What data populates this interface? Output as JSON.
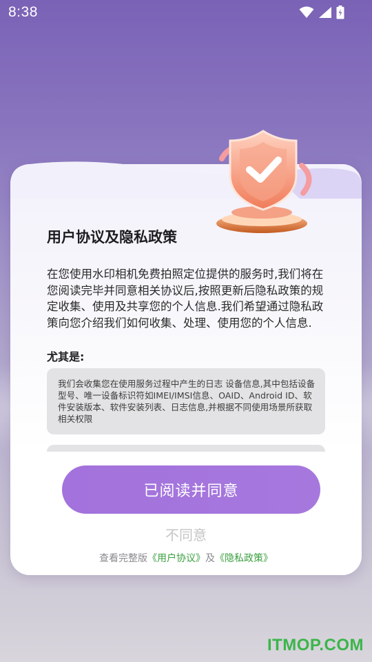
{
  "status_bar": {
    "time": "8:38",
    "icons": [
      "wifi-icon",
      "signal-icon",
      "battery-icon"
    ]
  },
  "dialog": {
    "title": "用户协议及隐私政策",
    "intro": "在您使用水印相机免费拍照定位提供的服务时,我们将在您阅读完毕并同意相关协议后,按照更新后隐私政策的规定收集、使用及共享您的个人信息.我们希望通过隐私政策向您介绍我们如何收集、处理、使用您的个人信息.",
    "especially_label": "尤其是:",
    "detail": "我们会收集您在使用服务过程中产生的日志 设备信息,其中包括设备型号、唯一设备标识符如IMEI/IMSI信息、OAID、Android ID、软件安装版本、软件安装列表、日志信息,并根据不同使用场景所获取相关权限",
    "agree_label": "已阅读并同意",
    "disagree_label": "不同意",
    "footer": {
      "prefix": "查看完整版",
      "user_agreement": "《用户协议》",
      "conjunction": "及",
      "privacy_policy": "《隐私政策》"
    }
  },
  "watermark": "ITMOP.COM",
  "colors": {
    "accent": "#a372dc",
    "link": "#3aa03f",
    "watermark": "#3bb54a"
  }
}
